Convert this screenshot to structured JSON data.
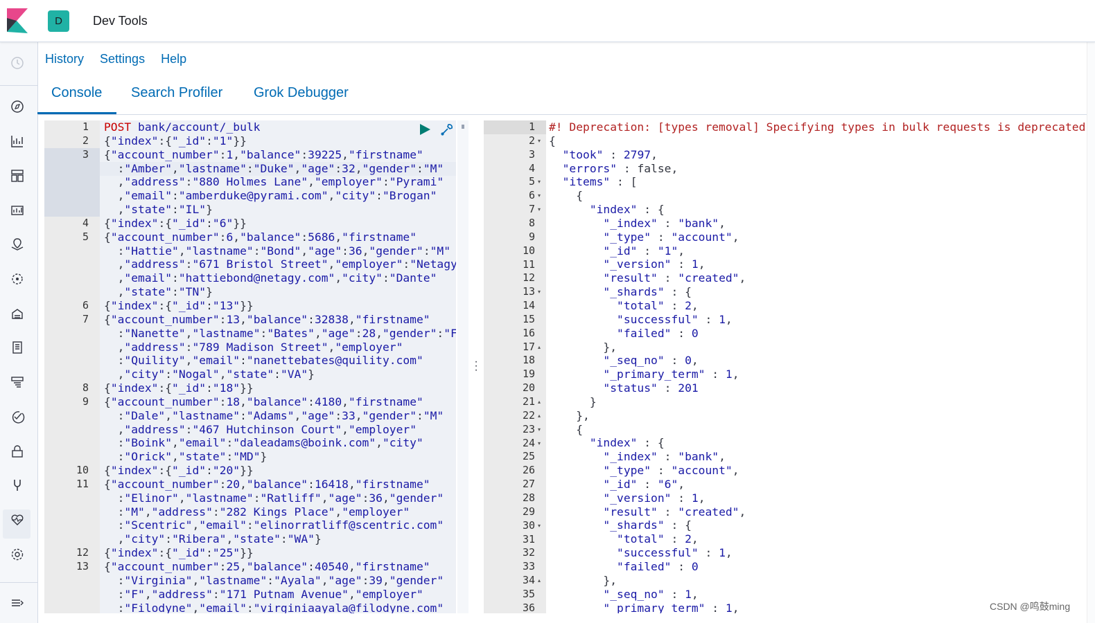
{
  "header": {
    "space_initial": "D",
    "app_title": "Dev Tools"
  },
  "nav_icons": [
    "clock-icon",
    "compass-icon",
    "visualize-icon",
    "dashboard-icon",
    "canvas-icon",
    "maps-icon",
    "ml-icon",
    "infrastructure-icon",
    "logs-icon",
    "apm-icon",
    "uptime-icon",
    "siem-icon",
    "devtools-icon",
    "monitoring-icon",
    "management-icon",
    "collapse-icon"
  ],
  "top_links": {
    "history": "History",
    "settings": "Settings",
    "help": "Help"
  },
  "tabs": {
    "console": "Console",
    "search_profiler": "Search Profiler",
    "grok_debugger": "Grok Debugger"
  },
  "request": {
    "line_numbers": [
      "1",
      "2",
      "3",
      "",
      "",
      "",
      "",
      "4",
      "5",
      "",
      "",
      "",
      "",
      "6",
      "7",
      "",
      "",
      "",
      "",
      "8",
      "9",
      "",
      "",
      "",
      "",
      "10",
      "11",
      "",
      "",
      "",
      "",
      "12",
      "13",
      "",
      "",
      ""
    ],
    "lines": [
      "POST bank/account/_bulk",
      "{\"index\":{\"_id\":\"1\"}}",
      "{\"account_number\":1,\"balance\":39225,\"firstname\"",
      "  :\"Amber\",\"lastname\":\"Duke\",\"age\":32,\"gender\":\"M\"",
      "  ,\"address\":\"880 Holmes Lane\",\"employer\":\"Pyrami\"",
      "  ,\"email\":\"amberduke@pyrami.com\",\"city\":\"Brogan\"",
      "  ,\"state\":\"IL\"}",
      "{\"index\":{\"_id\":\"6\"}}",
      "{\"account_number\":6,\"balance\":5686,\"firstname\"",
      "  :\"Hattie\",\"lastname\":\"Bond\",\"age\":36,\"gender\":\"M\"",
      "  ,\"address\":\"671 Bristol Street\",\"employer\":\"Netagy\"",
      "  ,\"email\":\"hattiebond@netagy.com\",\"city\":\"Dante\"",
      "  ,\"state\":\"TN\"}",
      "{\"index\":{\"_id\":\"13\"}}",
      "{\"account_number\":13,\"balance\":32838,\"firstname\"",
      "  :\"Nanette\",\"lastname\":\"Bates\",\"age\":28,\"gender\":\"F\"",
      "  ,\"address\":\"789 Madison Street\",\"employer\"",
      "  :\"Quility\",\"email\":\"nanettebates@quility.com\"",
      "  ,\"city\":\"Nogal\",\"state\":\"VA\"}",
      "{\"index\":{\"_id\":\"18\"}}",
      "{\"account_number\":18,\"balance\":4180,\"firstname\"",
      "  :\"Dale\",\"lastname\":\"Adams\",\"age\":33,\"gender\":\"M\"",
      "  ,\"address\":\"467 Hutchinson Court\",\"employer\"",
      "  :\"Boink\",\"email\":\"daleadams@boink.com\",\"city\"",
      "  :\"Orick\",\"state\":\"MD\"}",
      "{\"index\":{\"_id\":\"20\"}}",
      "{\"account_number\":20,\"balance\":16418,\"firstname\"",
      "  :\"Elinor\",\"lastname\":\"Ratliff\",\"age\":36,\"gender\"",
      "  :\"M\",\"address\":\"282 Kings Place\",\"employer\"",
      "  :\"Scentric\",\"email\":\"elinorratliff@scentric.com\"",
      "  ,\"city\":\"Ribera\",\"state\":\"WA\"}",
      "{\"index\":{\"_id\":\"25\"}}",
      "{\"account_number\":25,\"balance\":40540,\"firstname\"",
      "  :\"Virginia\",\"lastname\":\"Ayala\",\"age\":39,\"gender\"",
      "  :\"F\",\"address\":\"171 Putnam Avenue\",\"employer\"",
      "  :\"Filodyne\",\"email\":\"virginiaayala@filodyne.com\""
    ]
  },
  "response": {
    "line_numbers": [
      "1",
      "2",
      "3",
      "4",
      "5",
      "6",
      "7",
      "8",
      "9",
      "10",
      "11",
      "12",
      "13",
      "14",
      "15",
      "16",
      "17",
      "18",
      "19",
      "20",
      "21",
      "22",
      "23",
      "24",
      "25",
      "26",
      "27",
      "28",
      "29",
      "30",
      "31",
      "32",
      "33",
      "34",
      "35",
      "36"
    ],
    "fold_marks": [
      "",
      "▾",
      "",
      "",
      "▾",
      "▾",
      "▾",
      "",
      "",
      "",
      "",
      "",
      "▾",
      "",
      "",
      "",
      "▴",
      "",
      "",
      "",
      "▴",
      "▴",
      "▾",
      "▾",
      "",
      "",
      "",
      "",
      "",
      "▾",
      "",
      "",
      "",
      "▴",
      "",
      ""
    ],
    "lines": [
      "#! Deprecation: [types removal] Specifying types in bulk requests is deprecated.",
      "{",
      "  \"took\" : 2797,",
      "  \"errors\" : false,",
      "  \"items\" : [",
      "    {",
      "      \"index\" : {",
      "        \"_index\" : \"bank\",",
      "        \"_type\" : \"account\",",
      "        \"_id\" : \"1\",",
      "        \"_version\" : 1,",
      "        \"result\" : \"created\",",
      "        \"_shards\" : {",
      "          \"total\" : 2,",
      "          \"successful\" : 1,",
      "          \"failed\" : 0",
      "        },",
      "        \"_seq_no\" : 0,",
      "        \"_primary_term\" : 1,",
      "        \"status\" : 201",
      "      }",
      "    },",
      "    {",
      "      \"index\" : {",
      "        \"_index\" : \"bank\",",
      "        \"_type\" : \"account\",",
      "        \"_id\" : \"6\",",
      "        \"_version\" : 1,",
      "        \"result\" : \"created\",",
      "        \"_shards\" : {",
      "          \"total\" : 2,",
      "          \"successful\" : 1,",
      "          \"failed\" : 0",
      "        },",
      "        \"_seq_no\" : 1,",
      "        \"_primary_term\" : 1,"
    ]
  },
  "watermark": "CSDN @鸣鼓ming",
  "colors": {
    "accent": "#006bb4",
    "badge": "#20b2a5",
    "deprecation": "#b22222",
    "json": "#1a1aa6"
  }
}
